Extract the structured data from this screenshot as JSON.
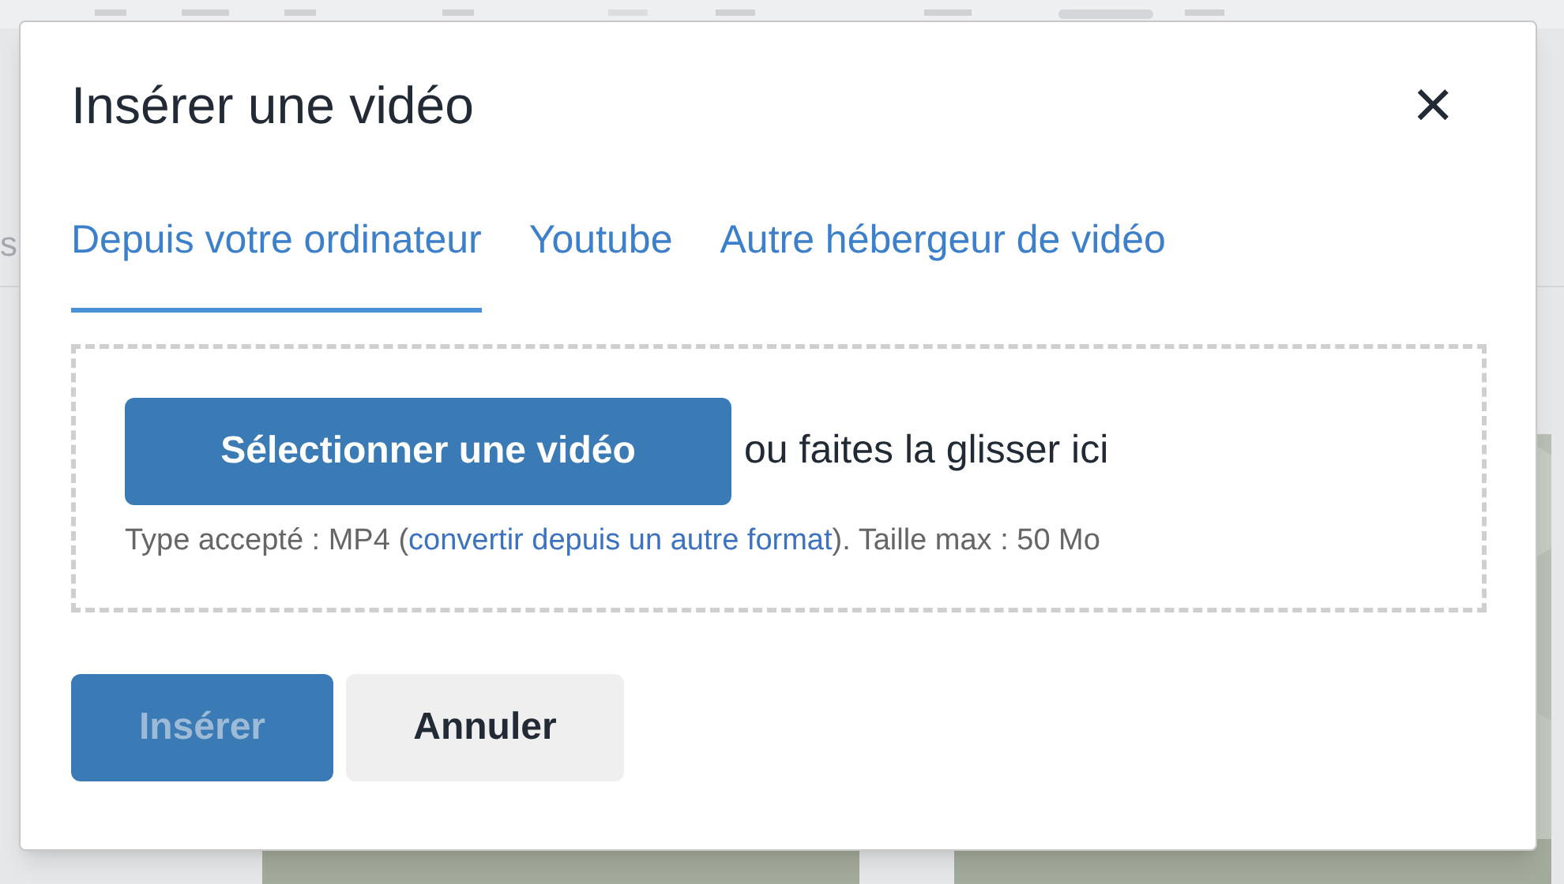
{
  "background": {
    "side_text": "s"
  },
  "dialog": {
    "title": "Insérer une vidéo",
    "close": "×",
    "tabs": [
      {
        "label": "Depuis votre ordinateur",
        "selected": true
      },
      {
        "label": "Youtube",
        "selected": false
      },
      {
        "label": "Autre hébergeur de vidéo",
        "selected": false
      }
    ],
    "dropzone": {
      "button": "Sélectionner une vidéo",
      "drag_text": "ou faites la glisser ici",
      "hint_before": "Type accepté : MP4 (",
      "hint_link": "convertir depuis un autre format",
      "hint_after": "). Taille max : 50 Mo"
    },
    "buttons": [
      {
        "label": "Insérer",
        "kind": "primary",
        "disabled": true
      },
      {
        "label": "Annuler",
        "kind": "secondary",
        "disabled": false
      }
    ]
  }
}
